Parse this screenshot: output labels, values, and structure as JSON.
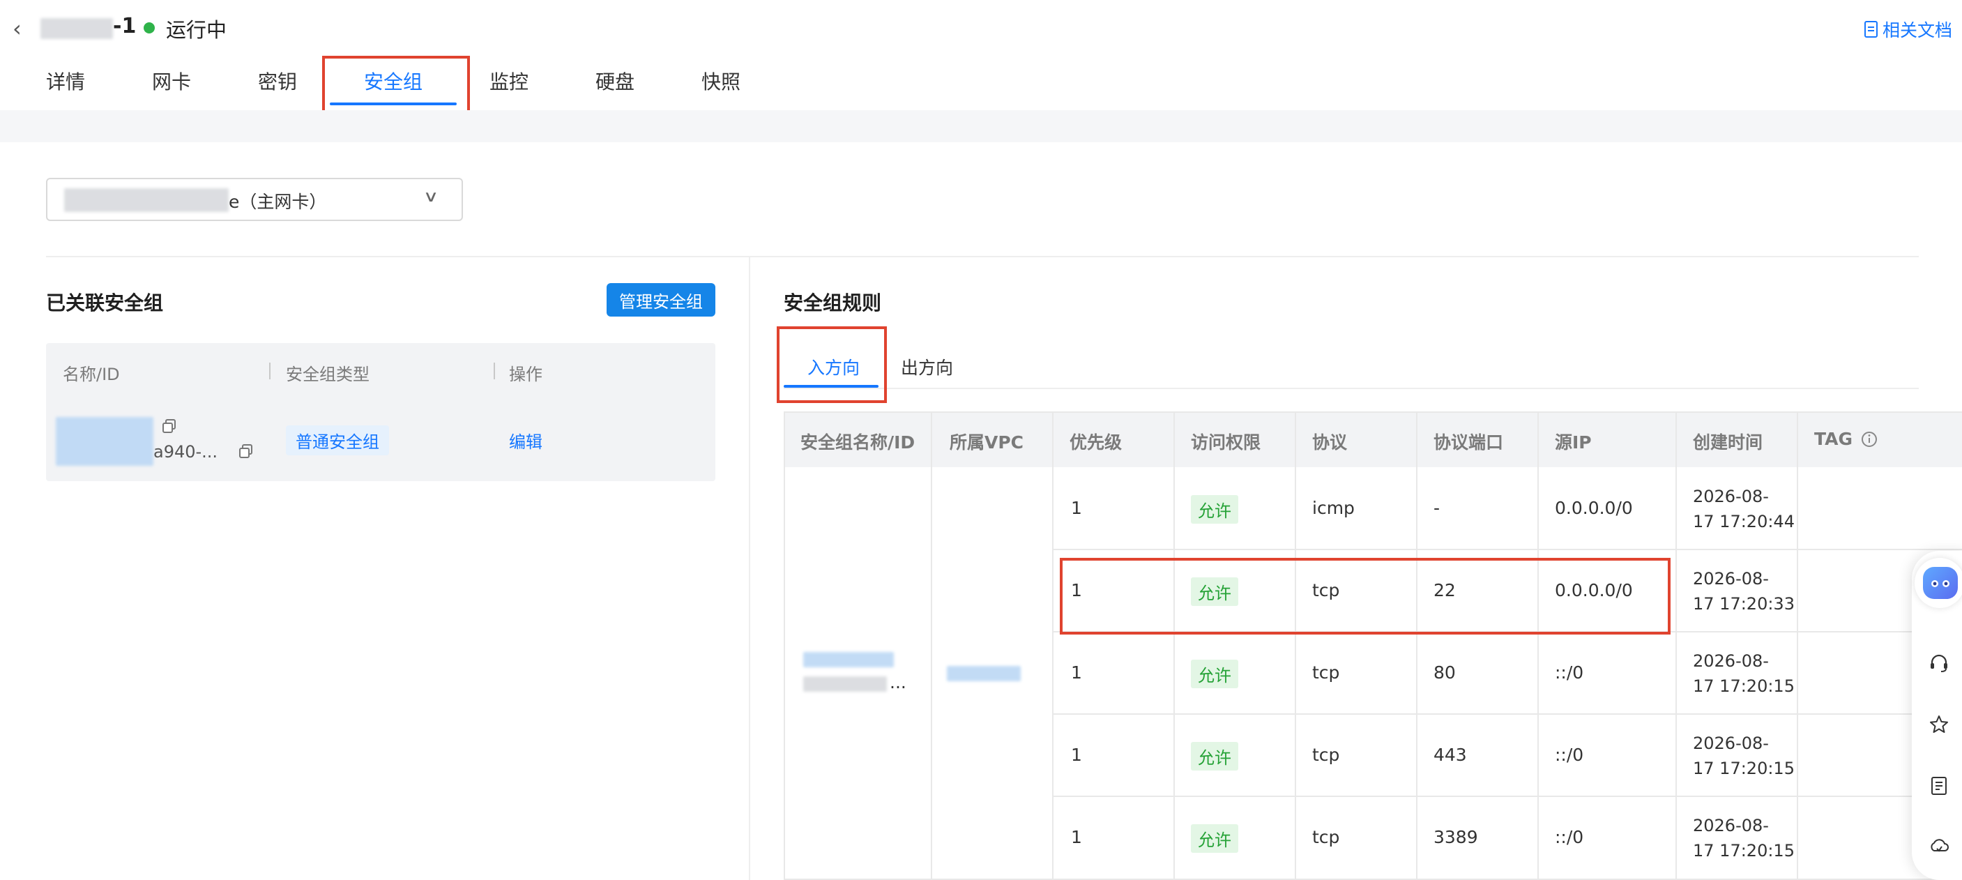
{
  "header": {
    "back_glyph": "‹",
    "instance_suffix": "-1",
    "status": "运行中",
    "docs_link": "相关文档",
    "status_color": "#2fb34a"
  },
  "tabs": [
    {
      "label": "详情"
    },
    {
      "label": "网卡"
    },
    {
      "label": "密钥"
    },
    {
      "label": "安全组"
    },
    {
      "label": "监控"
    },
    {
      "label": "硬盘"
    },
    {
      "label": "快照"
    }
  ],
  "active_tab": "安全组",
  "nic_select": {
    "value_suffix": "e（主网卡）",
    "chevron": "∨"
  },
  "linked_groups": {
    "title": "已关联安全组",
    "manage_button": "管理安全组",
    "columns": [
      "名称/ID",
      "安全组类型",
      "操作"
    ],
    "rows": [
      {
        "id_suffix": "a940-...",
        "type": "普通安全组",
        "action": "编辑"
      }
    ]
  },
  "rules": {
    "title": "安全组规则",
    "directions": [
      "入方向",
      "出方向"
    ],
    "active_direction": "入方向",
    "columns": [
      "安全组名称/ID",
      "所属VPC",
      "优先级",
      "访问权限",
      "协议",
      "协议端口",
      "源IP",
      "创建时间",
      "TAG"
    ],
    "group_name_ellipsis": "...",
    "rows": [
      {
        "priority": "1",
        "access": "允许",
        "protocol": "icmp",
        "port": "-",
        "source": "0.0.0.0/0",
        "created_date": "2026-08-",
        "created_time": "17 17:20:44"
      },
      {
        "priority": "1",
        "access": "允许",
        "protocol": "tcp",
        "port": "22",
        "source": "0.0.0.0/0",
        "created_date": "2026-08-",
        "created_time": "17 17:20:33"
      },
      {
        "priority": "1",
        "access": "允许",
        "protocol": "tcp",
        "port": "80",
        "source": "::/0",
        "created_date": "2026-08-",
        "created_time": "17 17:20:15"
      },
      {
        "priority": "1",
        "access": "允许",
        "protocol": "tcp",
        "port": "443",
        "source": "::/0",
        "created_date": "2026-08-",
        "created_time": "17 17:20:15"
      },
      {
        "priority": "1",
        "access": "允许",
        "protocol": "tcp",
        "port": "3389",
        "source": "::/0",
        "created_date": "2026-08-",
        "created_time": "17 17:20:15"
      }
    ]
  },
  "colors": {
    "accent": "#1677ff",
    "highlight": "#e0432f",
    "allow_text": "#25a236",
    "allow_bg": "#e3f6e5"
  }
}
